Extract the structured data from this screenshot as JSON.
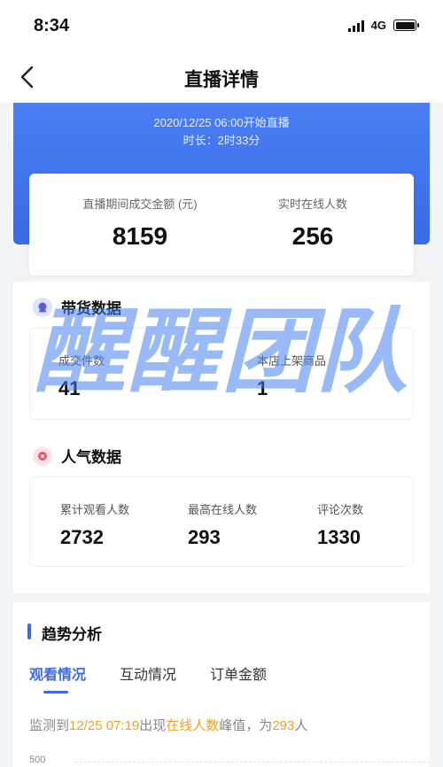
{
  "status_bar": {
    "time": "8:34",
    "network": "4G"
  },
  "nav": {
    "title": "直播详情"
  },
  "hero": {
    "start_line": "2020/12/25 06:00开始直播",
    "duration_line": "时长：2时33分"
  },
  "summary": {
    "gmv_label": "直播期间成交金额 (元)",
    "gmv_value": "8159",
    "online_label": "实时在线人数",
    "online_value": "256"
  },
  "goods_section": {
    "title": "带货数据",
    "orders_label": "成交件数",
    "orders_value": "41",
    "listed_label": "本店上架商品",
    "listed_value": "1"
  },
  "popularity_section": {
    "title": "人气数据",
    "views_label": "累计观看人数",
    "views_value": "2732",
    "peak_label": "最高在线人数",
    "peak_value": "293",
    "comments_label": "评论次数",
    "comments_value": "1330"
  },
  "trend": {
    "title": "趋势分析",
    "tabs": [
      {
        "label": "观看情况",
        "active": true
      },
      {
        "label": "互动情况",
        "active": false
      },
      {
        "label": "订单金额",
        "active": false
      }
    ],
    "monitor": {
      "prefix": "监测到",
      "time": "12/25 07:19",
      "mid": "出现",
      "metric": "在线人数",
      "mid2": "峰值，为",
      "value": "293",
      "suffix": "人"
    },
    "y_axis_top": "500"
  },
  "watermark": "醒醒团队",
  "colors": {
    "accent": "#3a6ae6",
    "highlight": "#f0a028"
  }
}
